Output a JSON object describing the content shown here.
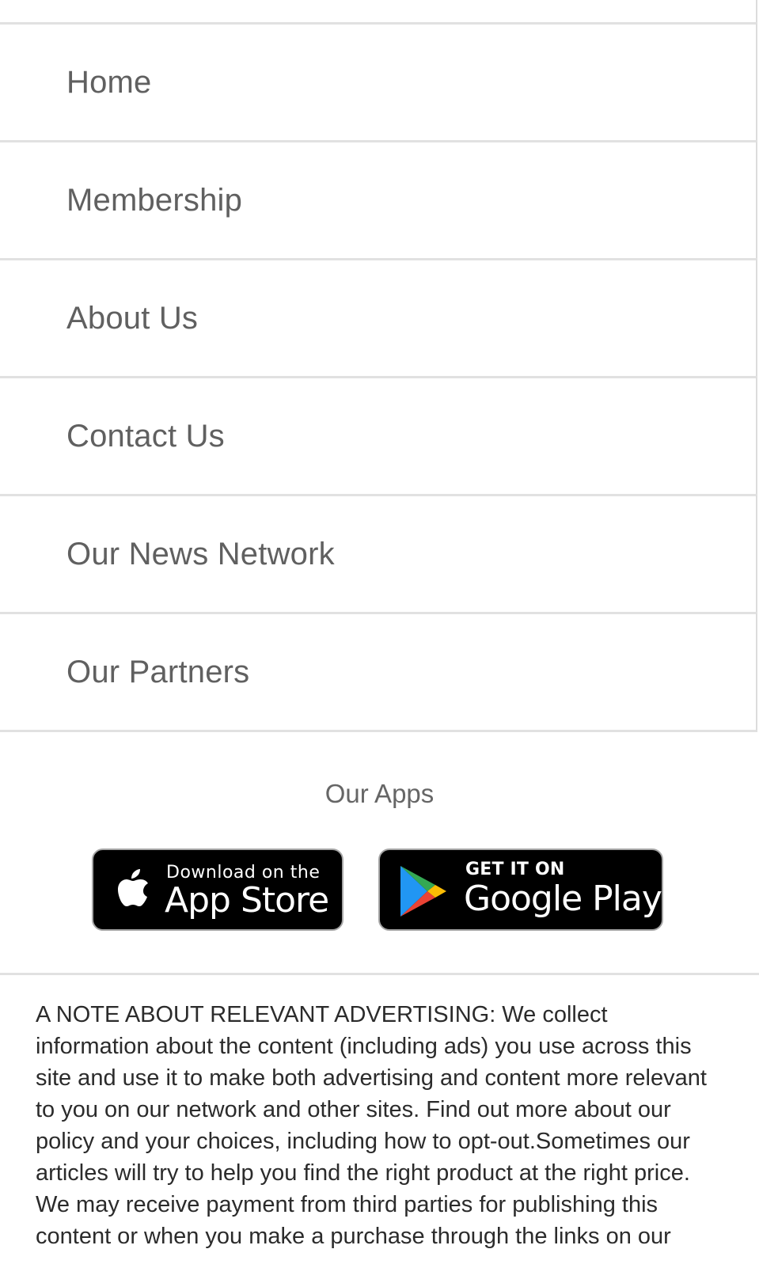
{
  "nav": {
    "items": [
      {
        "label": "Home"
      },
      {
        "label": "Membership"
      },
      {
        "label": "About Us"
      },
      {
        "label": "Contact Us"
      },
      {
        "label": "Our News Network"
      },
      {
        "label": "Our Partners"
      }
    ]
  },
  "apps": {
    "title": "Our Apps",
    "app_store": {
      "small": "Download on the",
      "big": "App Store",
      "icon": "apple-icon"
    },
    "google_play": {
      "small": "GET IT ON",
      "big": "Google Play",
      "icon": "play-icon"
    }
  },
  "footer": {
    "note": "A NOTE ABOUT RELEVANT ADVERTISING: We collect information about the content (including ads) you use across this site and use it to make both advertising and content more relevant to you on our network and other sites. Find out more about our policy and your choices, including how to opt-out.Sometimes our articles will try to help you find the right product at the right price. We may receive payment from third parties for publishing this content or when you make a purchase through the links on our"
  },
  "colors": {
    "divider": "#e1e1e1",
    "nav_text": "#606060",
    "note_text": "#2b2b2b",
    "badge_bg": "#000000"
  }
}
